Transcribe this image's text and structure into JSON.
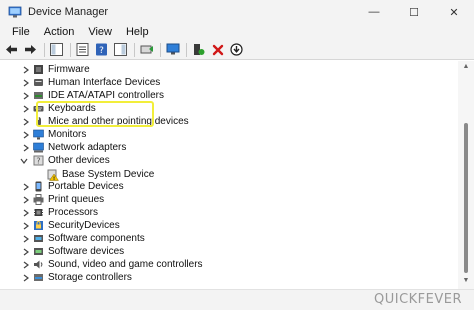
{
  "window": {
    "title": "Device Manager",
    "minimize": "—",
    "maximize": "☐",
    "close": "✕"
  },
  "menu": [
    "File",
    "Action",
    "View",
    "Help"
  ],
  "tree": [
    {
      "label": "Firmware",
      "icon": "firmware-icon",
      "expanded": false,
      "level": 1
    },
    {
      "label": "Human Interface Devices",
      "icon": "hid-icon",
      "expanded": false,
      "level": 1
    },
    {
      "label": "IDE ATA/ATAPI controllers",
      "icon": "ide-controller-icon",
      "expanded": false,
      "level": 1
    },
    {
      "label": "Keyboards",
      "icon": "keyboard-icon",
      "expanded": false,
      "level": 1
    },
    {
      "label": "Mice and other pointing devices",
      "icon": "mouse-icon",
      "expanded": false,
      "level": 1
    },
    {
      "label": "Monitors",
      "icon": "monitor-icon",
      "expanded": false,
      "level": 1
    },
    {
      "label": "Network adapters",
      "icon": "network-adapter-icon",
      "expanded": false,
      "level": 1
    },
    {
      "label": "Other devices",
      "icon": "other-devices-icon",
      "expanded": true,
      "level": 1
    },
    {
      "label": "Base System Device",
      "icon": "unknown-device-warning-icon",
      "expanded": null,
      "level": 2
    },
    {
      "label": "Portable Devices",
      "icon": "portable-device-icon",
      "expanded": false,
      "level": 1
    },
    {
      "label": "Print queues",
      "icon": "printer-icon",
      "expanded": false,
      "level": 1
    },
    {
      "label": "Processors",
      "icon": "processor-icon",
      "expanded": false,
      "level": 1
    },
    {
      "label": "SecurityDevices",
      "icon": "security-device-icon",
      "expanded": false,
      "level": 1
    },
    {
      "label": "Software components",
      "icon": "software-component-icon",
      "expanded": false,
      "level": 1
    },
    {
      "label": "Software devices",
      "icon": "software-device-icon",
      "expanded": false,
      "level": 1
    },
    {
      "label": "Sound, video and game controllers",
      "icon": "sound-icon",
      "expanded": false,
      "level": 1
    },
    {
      "label": "Storage controllers",
      "icon": "storage-controller-icon",
      "expanded": false,
      "level": 1
    }
  ],
  "watermark": "QUICKFEVER",
  "colors": {
    "highlight": "#f2ee3a",
    "chrome": "#f3f3f3",
    "warning": "#f2c200",
    "delete": "#d01818"
  }
}
